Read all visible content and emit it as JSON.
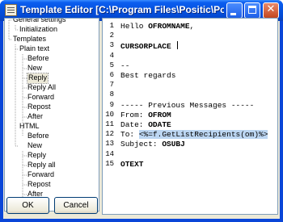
{
  "window": {
    "title": "Template Editor [C:\\Program Files\\Positic\\Potolook\\Templat...",
    "close_glyph": "✕"
  },
  "tree": {
    "items": [
      {
        "label": "General settings",
        "level": 1
      },
      {
        "label": "Initialization",
        "level": 2
      },
      {
        "label": "Templates",
        "level": 1
      },
      {
        "label": "Plain text",
        "level": 2
      },
      {
        "label": "Before",
        "level": 3
      },
      {
        "label": "New",
        "level": 3
      },
      {
        "label": "Reply",
        "level": 3,
        "selected": true
      },
      {
        "label": "Reply All",
        "level": 3
      },
      {
        "label": "Forward",
        "level": 3
      },
      {
        "label": "Repost",
        "level": 3
      },
      {
        "label": "After",
        "level": 3
      },
      {
        "label": "HTML",
        "level": 2
      },
      {
        "label": "Before",
        "level": 3
      },
      {
        "label": "New",
        "level": 3
      },
      {
        "label": "Reply",
        "level": 3
      },
      {
        "label": "Reply all",
        "level": 3
      },
      {
        "label": "Forward",
        "level": 3
      },
      {
        "label": "Repost",
        "level": 3
      },
      {
        "label": "After",
        "level": 3
      }
    ]
  },
  "editor": {
    "lines": [
      {
        "n": "1",
        "pre": "Hello ",
        "macro": "OFROMNAME",
        "post": ","
      },
      {
        "n": "2",
        "pre": "",
        "macro": "",
        "post": ""
      },
      {
        "n": "3",
        "pre": "",
        "macro": "CURSORPLACE",
        "post": " ",
        "caret": true
      },
      {
        "n": "4",
        "pre": "",
        "macro": "",
        "post": ""
      },
      {
        "n": "5",
        "pre": "--",
        "macro": "",
        "post": ""
      },
      {
        "n": "6",
        "pre": "Best regards",
        "macro": "",
        "post": ""
      },
      {
        "n": "7",
        "pre": "",
        "macro": "",
        "post": ""
      },
      {
        "n": "8",
        "pre": "",
        "macro": "",
        "post": ""
      },
      {
        "n": "9",
        "pre": "----- Previous Messages -----",
        "macro": "",
        "post": ""
      },
      {
        "n": "10",
        "pre": "From: ",
        "macro": "OFROM",
        "post": ""
      },
      {
        "n": "11",
        "pre": "Date: ",
        "macro": "ODATE",
        "post": ""
      },
      {
        "n": "12",
        "pre": "To: ",
        "macro": "",
        "post": "",
        "highlight": "<%=f.GetListRecipients(om)%>"
      },
      {
        "n": "13",
        "pre": "Subject: ",
        "macro": "OSUBJ",
        "post": ""
      },
      {
        "n": "14",
        "pre": "",
        "macro": "",
        "post": ""
      },
      {
        "n": "15",
        "pre": "",
        "macro": "OTEXT",
        "post": ""
      }
    ]
  },
  "buttons": {
    "ok": "OK",
    "cancel": "Cancel"
  }
}
